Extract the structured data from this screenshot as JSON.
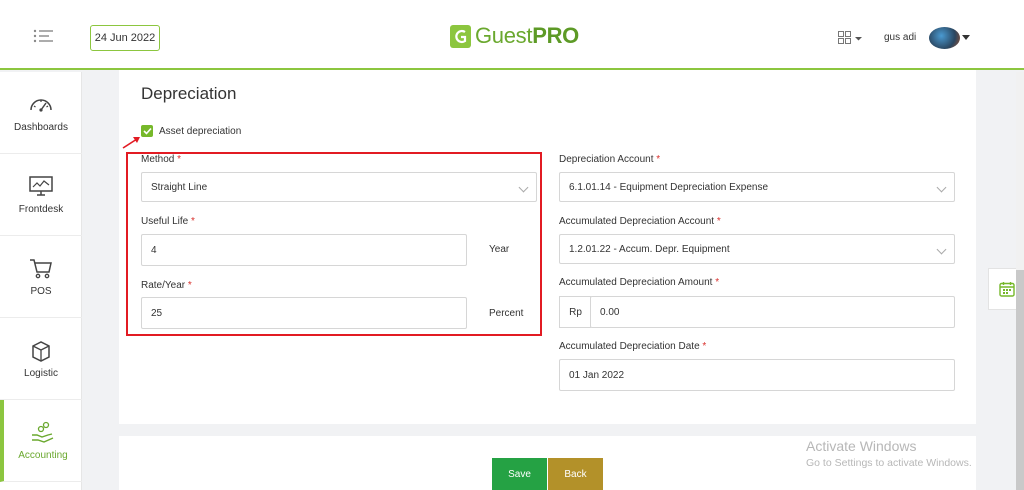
{
  "header": {
    "date": "24 Jun 2022",
    "brand_prefix": "Guest",
    "brand_suffix": "PRO",
    "username": "gus adi"
  },
  "sidebar": {
    "items": [
      {
        "label": "Dashboards",
        "icon": "gauge-icon"
      },
      {
        "label": "Frontdesk",
        "icon": "monitor-icon"
      },
      {
        "label": "POS",
        "icon": "cart-icon"
      },
      {
        "label": "Logistic",
        "icon": "box-icon"
      },
      {
        "label": "Accounting",
        "icon": "hand-coins-icon",
        "active": true
      }
    ]
  },
  "form": {
    "title": "Depreciation",
    "asset_depreciation_label": "Asset depreciation",
    "asset_depreciation_checked": true,
    "method": {
      "label": "Method",
      "value": "Straight Line"
    },
    "useful_life": {
      "label": "Useful Life",
      "value": "4",
      "unit": "Year"
    },
    "rate_year": {
      "label": "Rate/Year",
      "value": "25",
      "unit": "Percent"
    },
    "depreciation_account": {
      "label": "Depreciation Account",
      "value": "6.1.01.14 - Equipment Depreciation Expense"
    },
    "accumulated_depreciation_account": {
      "label": "Accumulated Depreciation Account",
      "value": "1.2.01.22 - Accum. Depr. Equipment"
    },
    "accumulated_depreciation_amount": {
      "label": "Accumulated Depreciation Amount",
      "prefix": "Rp",
      "value": "0.00"
    },
    "accumulated_depreciation_date": {
      "label": "Accumulated Depreciation Date",
      "value": "01 Jan 2022"
    },
    "required_marker": "*"
  },
  "actions": {
    "save_label": "Save",
    "back_label": "Back"
  },
  "watermark": {
    "title": "Activate Windows",
    "subtitle": "Go to Settings to activate Windows."
  },
  "colors": {
    "brand_green": "#8cc63f",
    "save_green": "#25a244",
    "back_gold": "#b39129",
    "highlight_red": "#e21b23",
    "required_red": "#d9302c"
  }
}
